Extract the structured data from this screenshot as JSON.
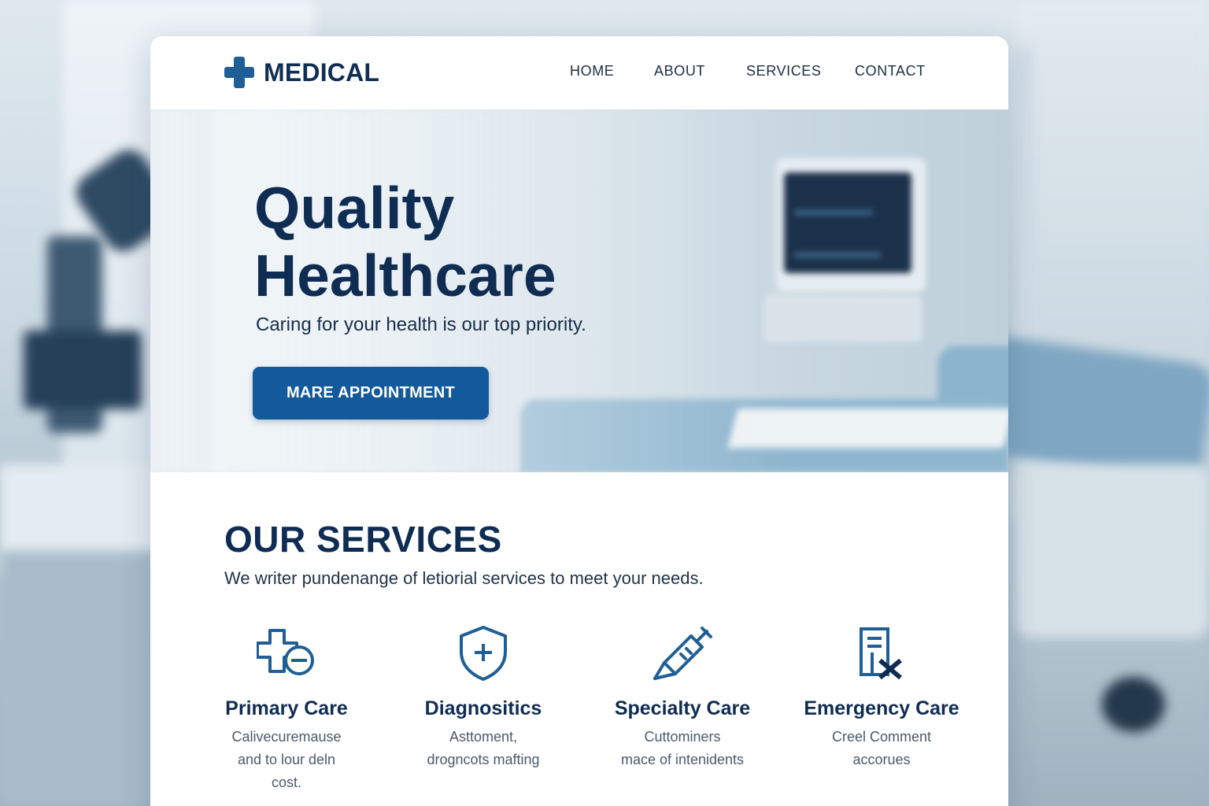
{
  "brand": {
    "name": "MEDICAL",
    "logo_icon": "medical-cross-icon",
    "accent_color": "#135a9c",
    "heading_color": "#0f2c52"
  },
  "nav": {
    "items": [
      {
        "label": "HOME"
      },
      {
        "label": "ABOUT"
      },
      {
        "label": "SERVICES"
      },
      {
        "label": "CONTACT"
      }
    ]
  },
  "hero": {
    "title_line1": "Quality",
    "title_line2": "Healthcare",
    "subtitle": "Caring for your health is our top priority.",
    "cta_label": "MARE APPOINTMENT"
  },
  "services": {
    "title": "OUR SERVICES",
    "subtitle": "We writer pundenange of letiorial services to meet your needs.",
    "items": [
      {
        "icon": "cross-minus-icon",
        "title": "Primary Care",
        "desc_line1": "Calivecuremause",
        "desc_line2": "and to lour deln",
        "desc_line3": "cost."
      },
      {
        "icon": "shield-plus-icon",
        "title": "Diagnositics",
        "desc_line1": "Asttoment,",
        "desc_line2": "drogncots mafting",
        "desc_line3": ""
      },
      {
        "icon": "syringe-icon",
        "title": "Specialty Care",
        "desc_line1": "Cuttominers",
        "desc_line2": "mace of intenidents",
        "desc_line3": ""
      },
      {
        "icon": "prescription-icon",
        "title": "Emergency Care",
        "desc_line1": "Creel Comment",
        "desc_line2": "accorues",
        "desc_line3": ""
      }
    ]
  }
}
